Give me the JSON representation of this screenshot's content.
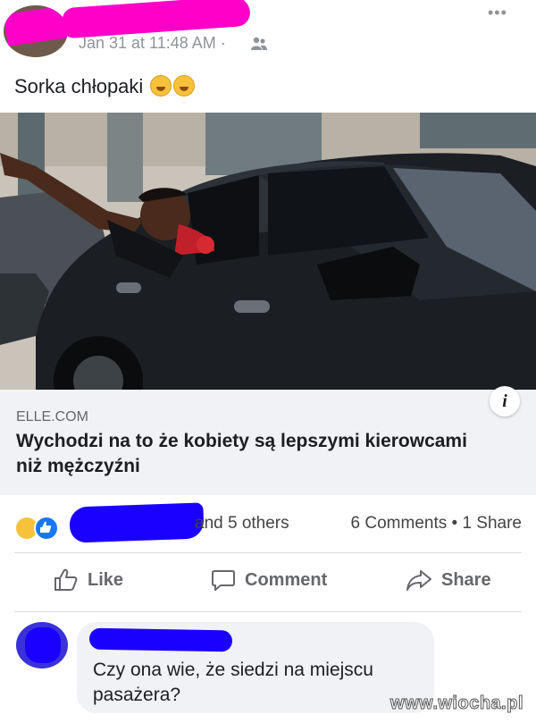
{
  "post": {
    "timestamp": "Jan 31 at 11:48 AM ·",
    "text": "Sorka chłopaki",
    "more_label": "•••"
  },
  "link": {
    "domain": "ELLE.COM",
    "title": "Wychodzi na to że kobiety są lepszymi kierowcami niż mężczyźni",
    "info_label": "i"
  },
  "reactions": {
    "others": "and 5 others",
    "counts": "6 Comments • 1 Share"
  },
  "actions": {
    "like": "Like",
    "comment": "Comment",
    "share": "Share"
  },
  "comment": {
    "text": "Czy ona wie, że siedzi na miejscu pasażera?"
  },
  "watermark": "www.wiocha.pl",
  "colors": {
    "redaction_pink": "#ff00c8",
    "redaction_blue": "#1a00ff",
    "link_preview_bg": "#f0f2f5",
    "like_blue": "#1877f2"
  }
}
